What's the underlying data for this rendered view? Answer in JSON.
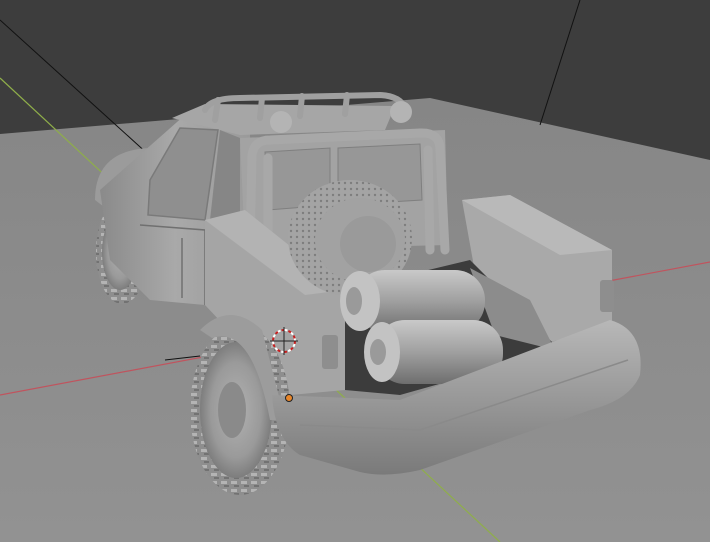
{
  "viewport": {
    "background_color": "#3d3d3d",
    "floor_color": "#8d8d8d",
    "x_axis_color": "#c0545e",
    "y_axis_color": "#8fae4a",
    "origin_color": "#e8862a",
    "cursor_color": "#c81e1e"
  },
  "scene": {
    "objects": [
      {
        "name": "offroad-pickup-truck",
        "shading": "solid",
        "material_color": "#a7a7a7"
      },
      {
        "name": "spare-tire"
      },
      {
        "name": "gas-tank-upper"
      },
      {
        "name": "gas-tank-lower"
      },
      {
        "name": "roll-cage"
      },
      {
        "name": "roof-rack"
      }
    ]
  },
  "gizmos": [
    "3d-cursor",
    "object-origin"
  ]
}
